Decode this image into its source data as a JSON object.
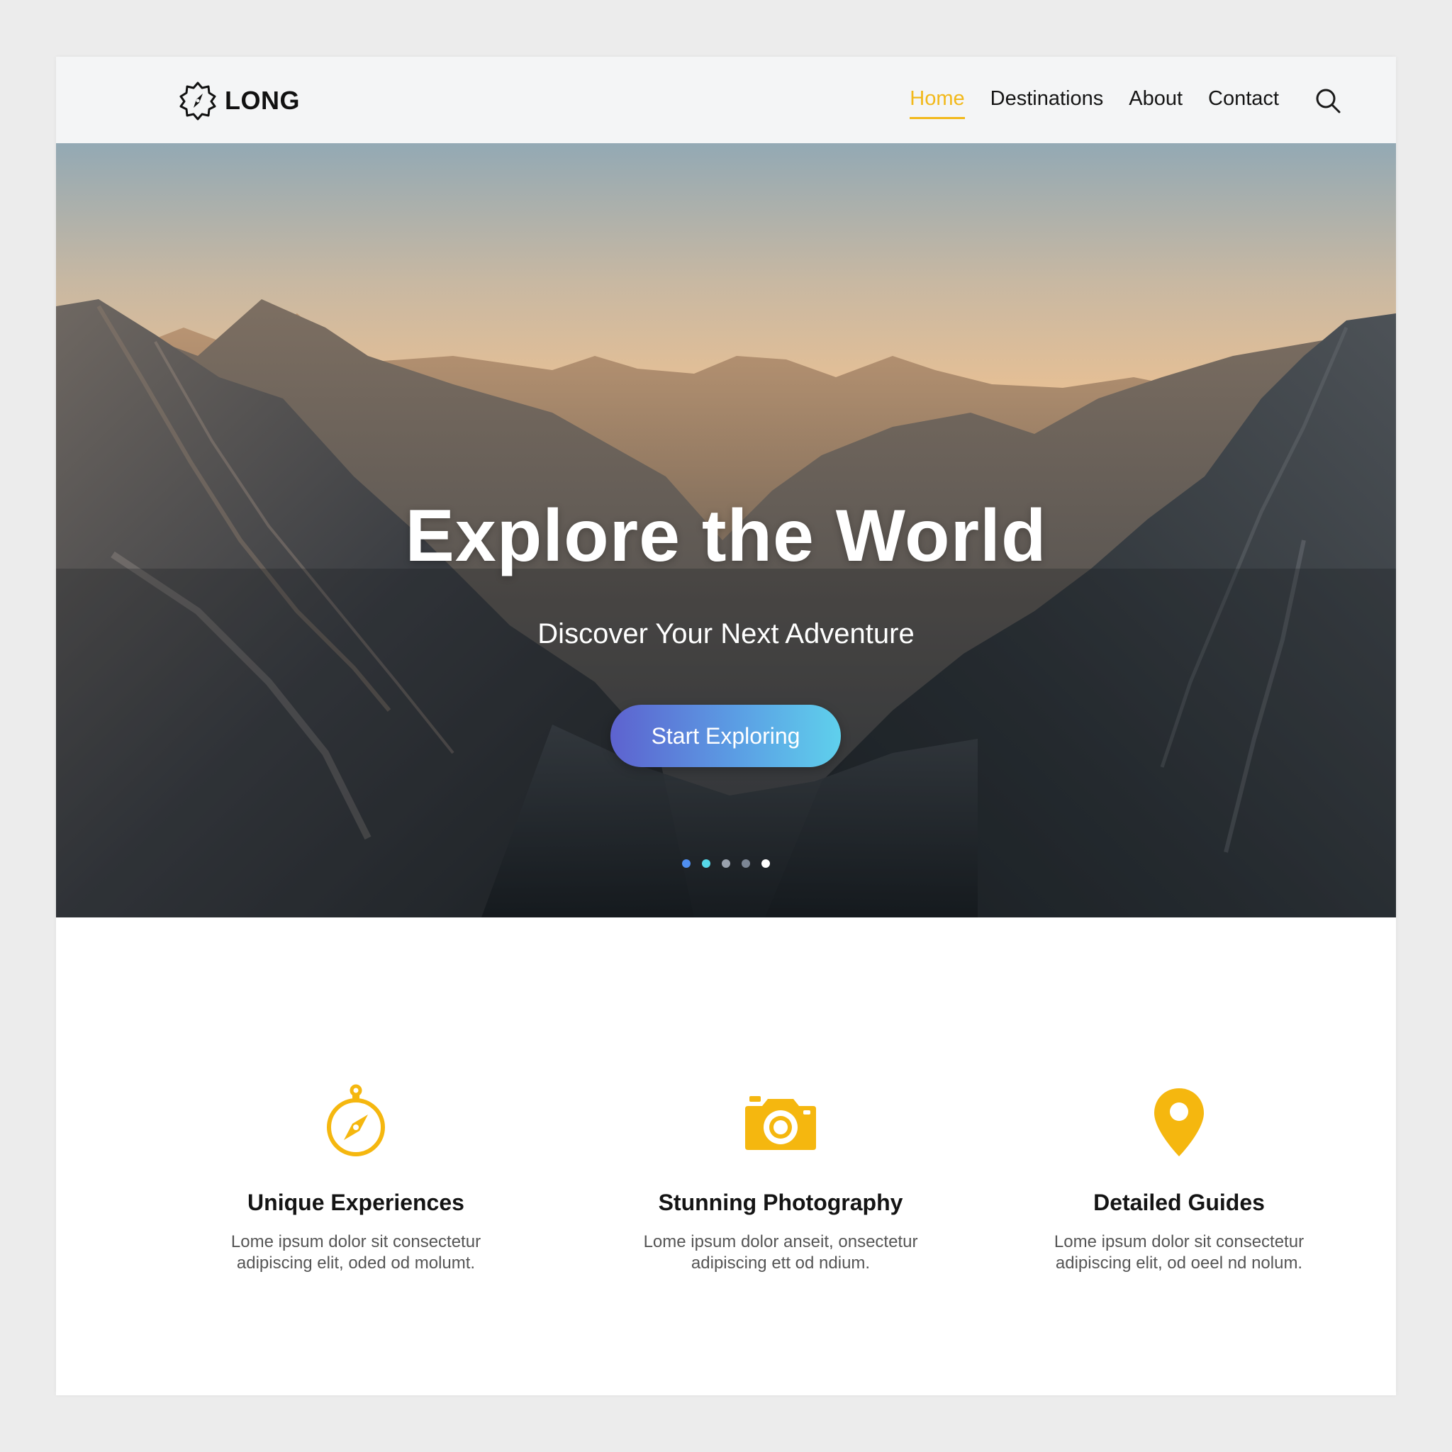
{
  "brand": {
    "name": "LONG",
    "logo_icon": "compass-badge-icon"
  },
  "nav": {
    "items": [
      {
        "label": "Home",
        "active": true
      },
      {
        "label": "Destinations",
        "active": false
      },
      {
        "label": "About",
        "active": false
      },
      {
        "label": "Contact",
        "active": false
      }
    ],
    "search_icon": "search-icon"
  },
  "hero": {
    "title": "Explore the World",
    "subtitle": "Discover Your Next Adventure",
    "cta_label": "Start Exploring",
    "carousel": {
      "count": 5,
      "dot_colors": [
        "#4f8ff0",
        "#56d8e8",
        "#9aa2ad",
        "#7c8694",
        "#ffffff"
      ]
    }
  },
  "features": [
    {
      "icon": "compass-icon",
      "title": "Unique Experiences",
      "description": "Lome ipsum dolor sit consectetur adipiscing elit, oded od molumt."
    },
    {
      "icon": "camera-icon",
      "title": "Stunning Photography",
      "description": "Lome ipsum dolor anseit, onsectetur adipiscing ett od ndium."
    },
    {
      "icon": "map-pin-icon",
      "title": "Detailed Guides",
      "description": "Lome ipsum dolor sit consectetur adipiscing elit, od oeel nd nolum."
    }
  ],
  "colors": {
    "accent": "#f2b91b",
    "cta_gradient_start": "#5d62cf",
    "cta_gradient_end": "#5fd0ec",
    "header_bg": "#f4f5f6",
    "text": "#151515"
  }
}
